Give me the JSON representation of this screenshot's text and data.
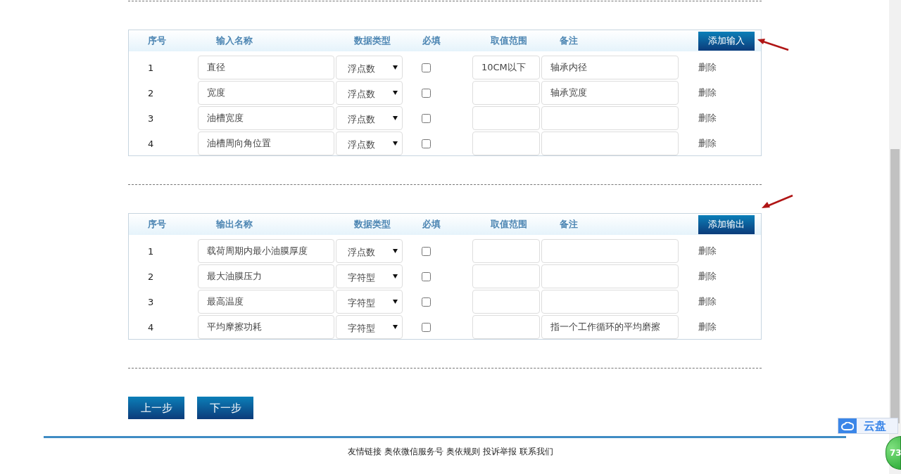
{
  "sections": [
    {
      "columns": [
        "序号",
        "输入名称",
        "数据类型",
        "必填",
        "取值范围",
        "备注"
      ],
      "add_button": "添加输入",
      "annotated": true,
      "rows": [
        {
          "index": "1",
          "name": "直径",
          "data_type": "浮点数",
          "required": false,
          "range": "10CM以下",
          "note": "轴承内径",
          "delete": "删除"
        },
        {
          "index": "2",
          "name": "宽度",
          "data_type": "浮点数",
          "required": false,
          "note": "轴承宽度",
          "delete": "删除"
        },
        {
          "index": "3",
          "name": "油槽宽度",
          "data_type": "浮点数",
          "required": false,
          "delete": "删除"
        },
        {
          "index": "4",
          "name": "油槽周向角位置",
          "data_type": "浮点数",
          "required": false,
          "delete": "删除"
        }
      ]
    },
    {
      "columns": [
        "序号",
        "输出名称",
        "数据类型",
        "必填",
        "取值范围",
        "备注"
      ],
      "add_button": "添加输出",
      "annotated": true,
      "rows": [
        {
          "index": "1",
          "name": "载荷周期内最小油膜厚度",
          "data_type": "浮点数",
          "required": false,
          "delete": "删除"
        },
        {
          "index": "2",
          "name": "最大油膜压力",
          "data_type": "字符型",
          "required": false,
          "delete": "删除"
        },
        {
          "index": "3",
          "name": "最高温度",
          "data_type": "字符型",
          "required": false,
          "delete": "删除"
        },
        {
          "index": "4",
          "name": "平均摩擦功耗",
          "data_type": "字符型",
          "required": false,
          "note": "指一个工作循环的平均磨擦",
          "delete": "删除"
        }
      ]
    }
  ],
  "nav_buttons": [
    "上一步",
    "下一步"
  ],
  "footer_links": [
    "友情链接",
    "奥依微信服务号",
    "奥依规则",
    "投诉举报",
    "联系我们"
  ],
  "cloud_widget": {
    "label": "云盘"
  },
  "badge": "73"
}
